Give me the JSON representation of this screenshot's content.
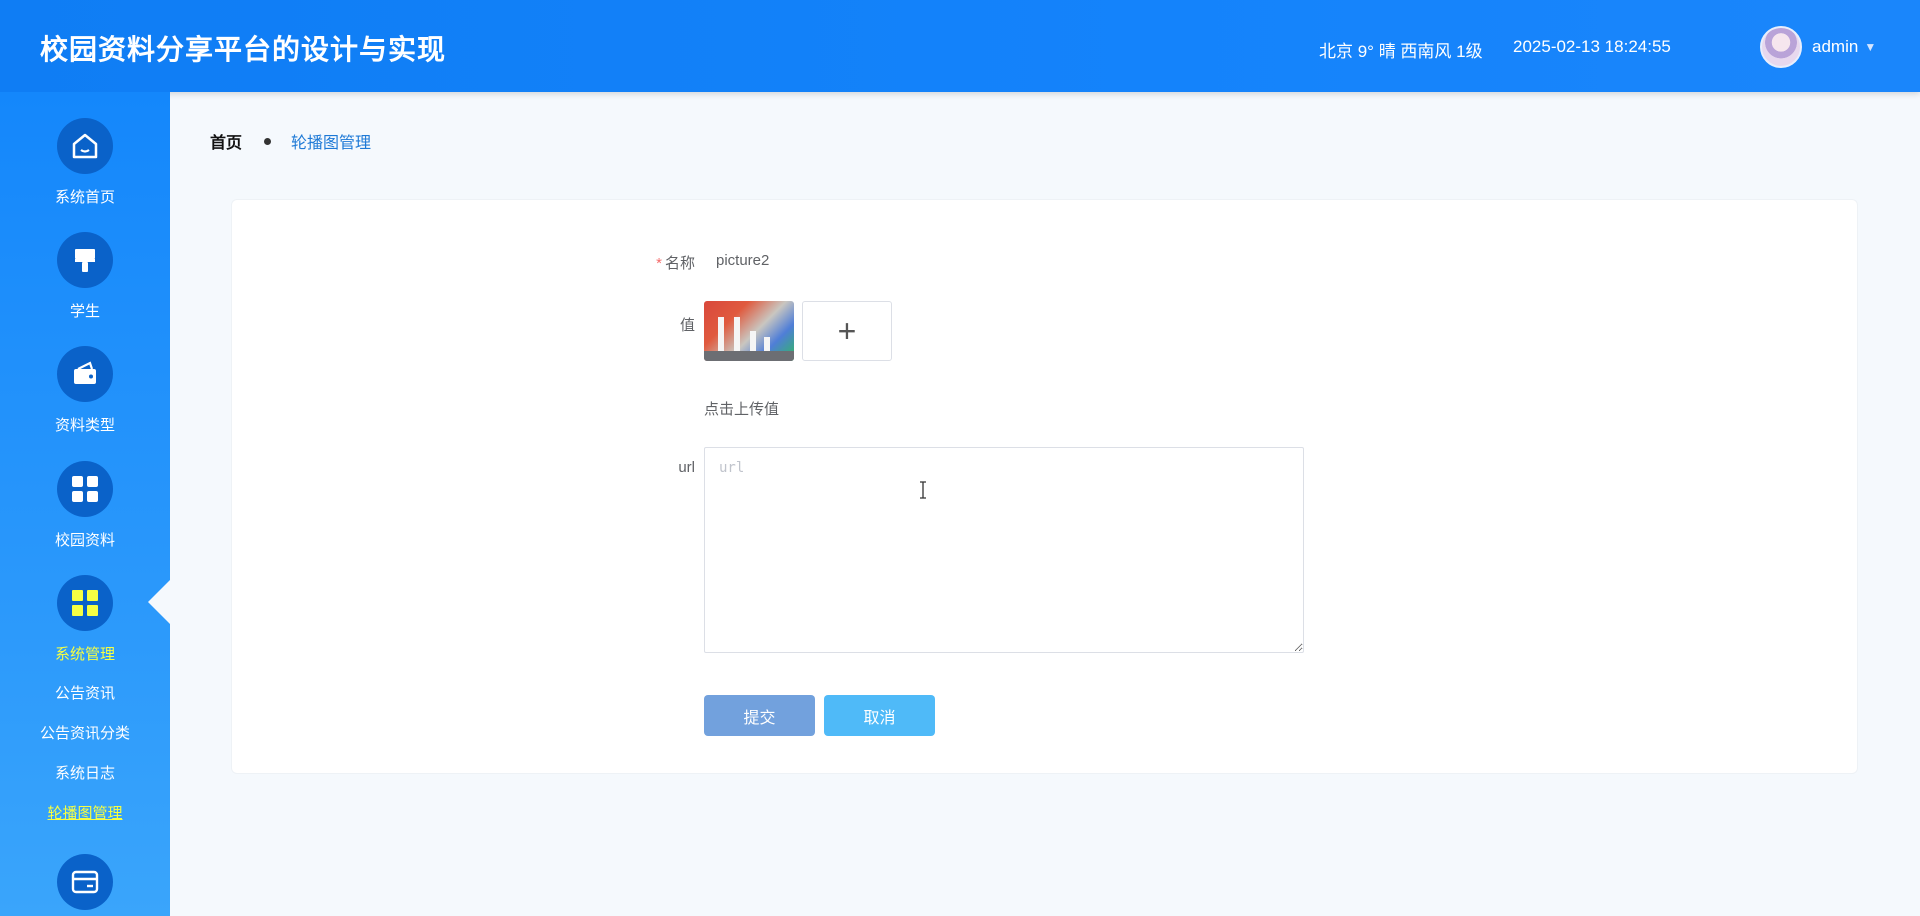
{
  "header": {
    "title": "校园资料分享平台的设计与实现",
    "weather": "北京 9° 晴 西南风 1级",
    "datetime": "2025-02-13 18:24:55",
    "username": "admin",
    "caret": "▼"
  },
  "sidebar": {
    "items": [
      {
        "label": "系统首页",
        "icon": "home-icon"
      },
      {
        "label": "学生",
        "icon": "brush-icon"
      },
      {
        "label": "资料类型",
        "icon": "wallet-icon"
      },
      {
        "label": "校园资料",
        "icon": "grid-icon"
      },
      {
        "label": "系统管理",
        "icon": "grid-icon",
        "active": true
      },
      {
        "label": "",
        "icon": "card-icon"
      }
    ],
    "submenu": [
      {
        "label": "公告资讯"
      },
      {
        "label": "公告资讯分类"
      },
      {
        "label": "系统日志"
      },
      {
        "label": "轮播图管理",
        "active": true
      }
    ],
    "active_color": "#f6ff43"
  },
  "breadcrumb": {
    "home": "首页",
    "current": "轮播图管理"
  },
  "form": {
    "name_label": "名称",
    "required_mark": "*",
    "name_value": "picture2",
    "value_label": "值",
    "upload_plus": "+",
    "upload_hint": "点击上传值",
    "url_label": "url",
    "url_placeholder": "url",
    "submit_label": "提交",
    "cancel_label": "取消"
  },
  "colors": {
    "header_bg": "#1483fb",
    "submit_bg": "#72a1dd",
    "cancel_bg": "#4fbaf8",
    "breadcrumb_active": "#1d79d6"
  }
}
